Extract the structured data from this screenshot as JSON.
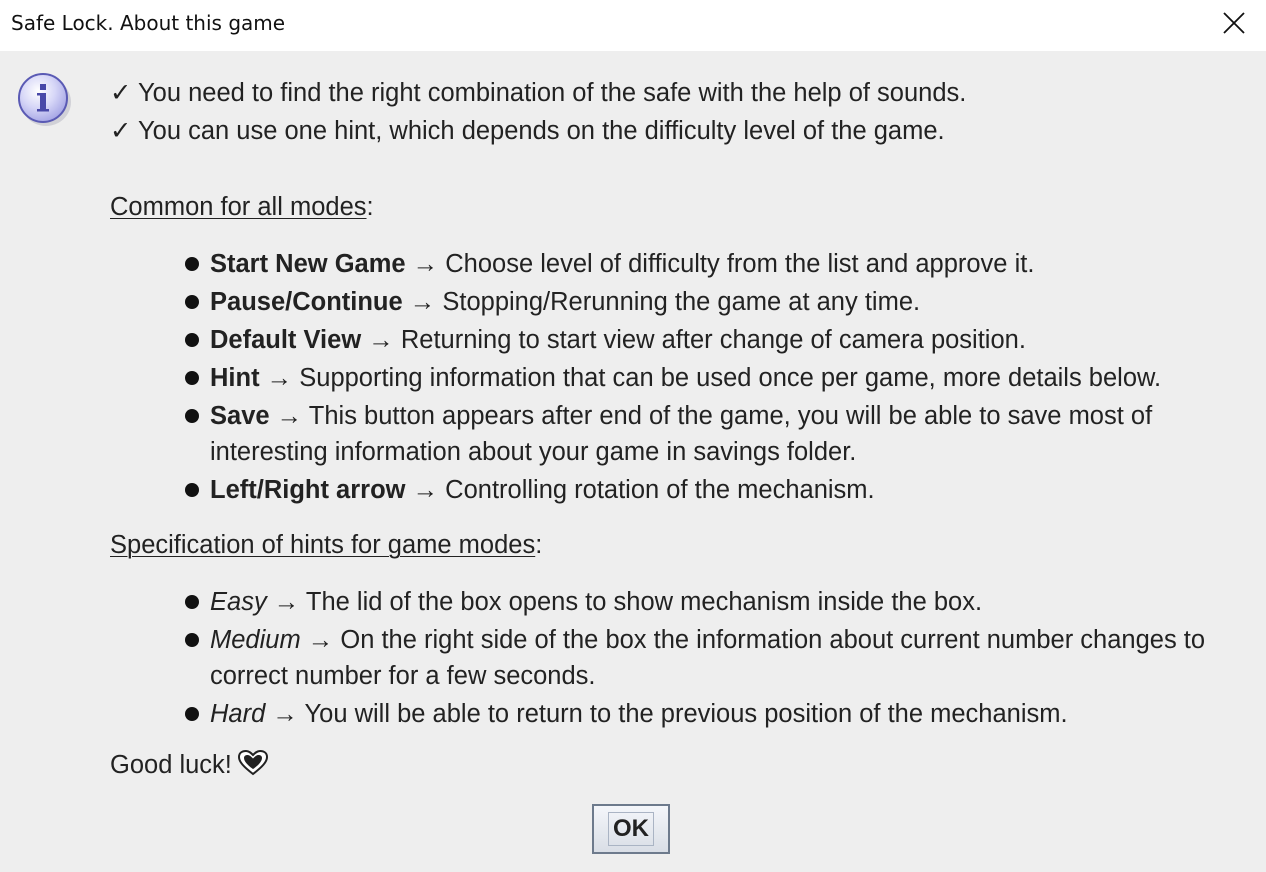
{
  "window": {
    "title": "Safe Lock. About this game",
    "close_glyph": "✕"
  },
  "dialog": {
    "icon": "info-icon",
    "check_lines": [
      "✓ You need to find the right combination of the safe with the help of sounds.",
      "✓ You can use one hint, which depends on the difficulty level of the game."
    ],
    "common_heading": "Common for all modes",
    "common_items": [
      {
        "term": "Start New Game",
        "desc": " → Choose level of difficulty from the list and approve it."
      },
      {
        "term": "Pause/Continue",
        "desc": " → Stopping/Rerunning the game at any time."
      },
      {
        "term": "Default View",
        "desc": " → Returning to start view after change of camera position."
      },
      {
        "term": "Hint",
        "desc": " → Supporting information that can be used once per game, more details below."
      },
      {
        "term": "Save",
        "desc": " → This button appears after end of the game, you will be able to save most of interesting information about your game in savings folder."
      },
      {
        "term": "Left/Right arrow",
        "desc": " → Controlling rotation of the mechanism."
      }
    ],
    "hints_heading": "Specification of hints for game modes",
    "hint_items": [
      {
        "term": "Easy",
        "desc": " → The lid of the box opens to show mechanism inside the box."
      },
      {
        "term": "Medium",
        "desc": " → On the right side of the box the information about current number changes to correct number for a few seconds."
      },
      {
        "term": "Hard",
        "desc": " → You will be able to return to the previous position of the mechanism."
      }
    ],
    "closing": "Good luck!",
    "heart_icon": "heart-icon",
    "ok_label": "OK"
  }
}
